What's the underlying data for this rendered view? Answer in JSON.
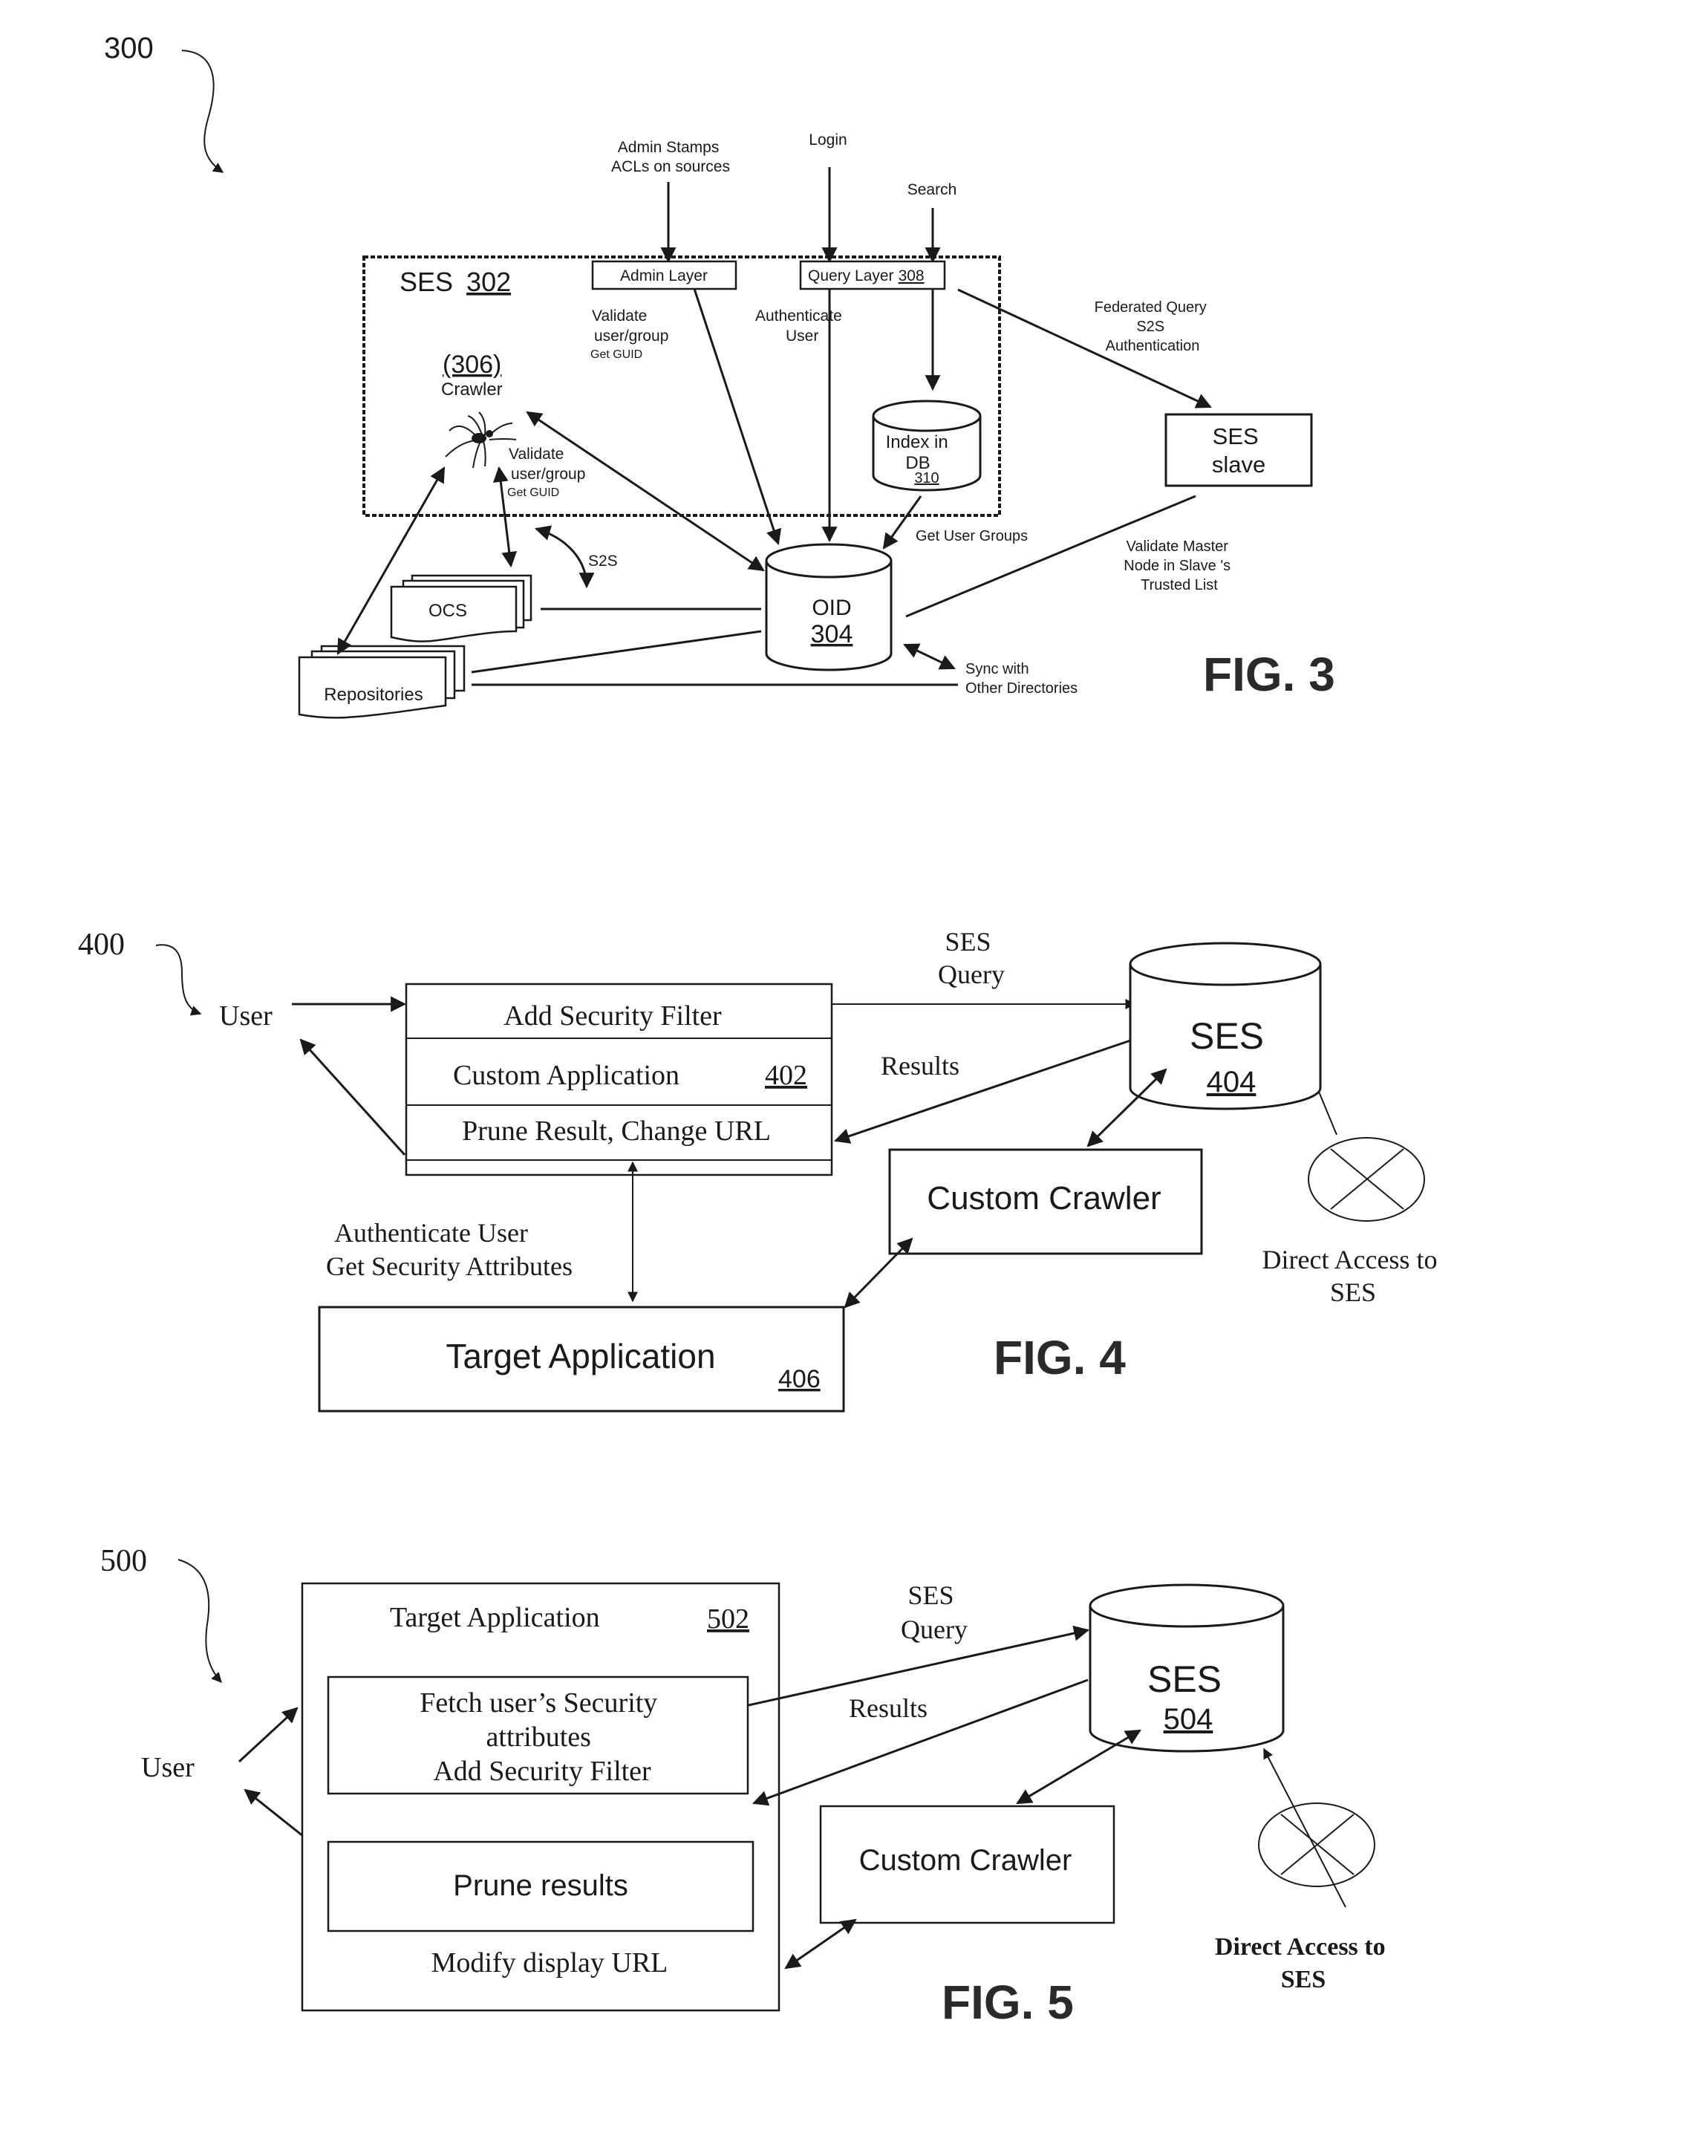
{
  "fig3": {
    "ref": "300",
    "caption": "FIG. 3",
    "ses_box": {
      "label": "SES",
      "ref": "302"
    },
    "admin_layer": "Admin Layer",
    "query_layer": {
      "label": "Query Layer",
      "ref": "308"
    },
    "admin_input": [
      "Admin Stamps",
      "ACLs  on sources"
    ],
    "login_input": "Login",
    "search_input": "Search",
    "validate_admin": [
      "Validate",
      "user/group",
      "Get GUID"
    ],
    "authenticate_user": [
      "Authenticate",
      "User"
    ],
    "crawler": {
      "ref": "(306)",
      "label": "Crawler"
    },
    "validate_crawler": [
      "Validate",
      "user/group",
      "Get GUID"
    ],
    "index_db": {
      "lines": [
        "Index in",
        "DB"
      ],
      "ref": "310"
    },
    "federated": [
      "Federated Query",
      "S2S",
      "Authentication"
    ],
    "ses_slave": [
      "SES",
      "slave"
    ],
    "get_user_groups": "Get User Groups",
    "validate_master": [
      "Validate Master",
      "Node in Slave 's",
      "Trusted List"
    ],
    "s2s": "S2S",
    "ocs": "OCS",
    "oid": {
      "label": "OID",
      "ref": "304"
    },
    "repositories": "Repositories",
    "sync": [
      "Sync with",
      "Other Directories"
    ]
  },
  "fig4": {
    "ref": "400",
    "caption": "FIG. 4",
    "user": "User",
    "custom_app": {
      "rows": [
        "Add Security Filter",
        "Custom Application",
        "Prune Result, Change URL"
      ],
      "ref": "402"
    },
    "ses_query": [
      "SES",
      "Query"
    ],
    "results": "Results",
    "ses": {
      "label": "SES",
      "ref": "404"
    },
    "custom_crawler": "Custom Crawler",
    "direct_access": [
      "Direct  Access to",
      "SES"
    ],
    "auth_label": [
      "Authenticate User",
      "Get Security Attributes"
    ],
    "target_app": {
      "label": "Target Application",
      "ref": "406"
    }
  },
  "fig5": {
    "ref": "500",
    "caption": "FIG. 5",
    "user": "User",
    "target_app": {
      "label": "Target Application",
      "ref": "502"
    },
    "fetch_box": [
      "Fetch user’s Security",
      "attributes",
      "Add Security Filter"
    ],
    "prune_box": "Prune results",
    "modify_url": "Modify display URL",
    "ses_query": [
      "SES",
      "Query"
    ],
    "results": "Results",
    "ses": {
      "label": "SES",
      "ref": "504"
    },
    "custom_crawler": "Custom Crawler",
    "direct_access": [
      "Direct Access to",
      "SES"
    ]
  }
}
